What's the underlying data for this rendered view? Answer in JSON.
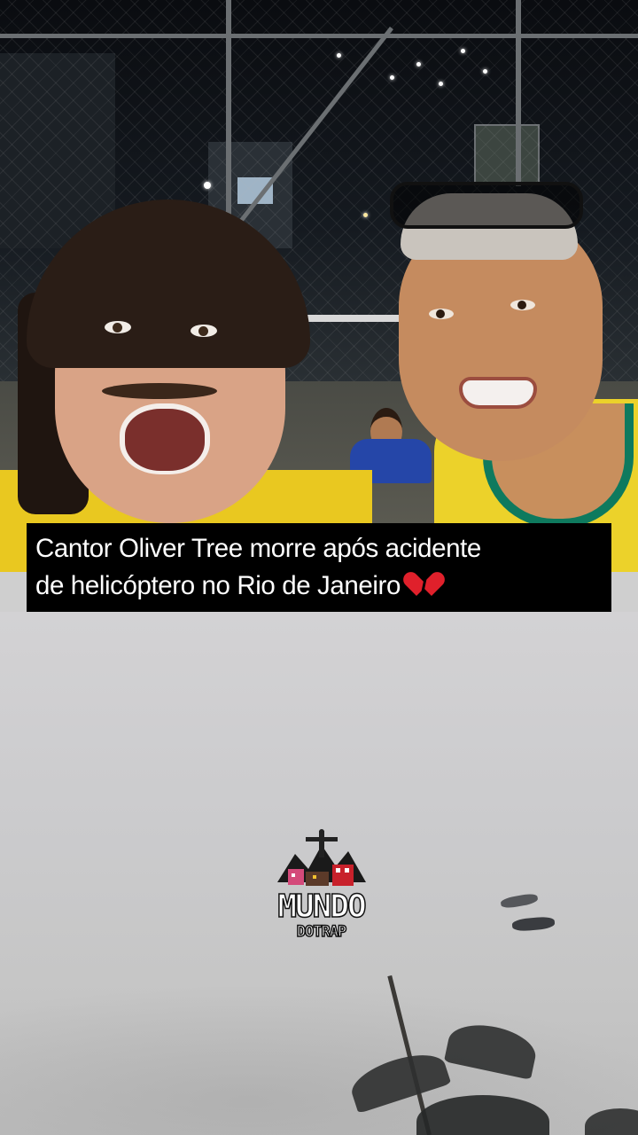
{
  "caption": {
    "line1": "Cantor Oliver Tree morre após acidente",
    "line2": "de helicóptero no Rio de Janeiro",
    "emoji": "broken-heart-icon"
  },
  "logo": {
    "line1": "MUNDO",
    "line2": "DOTRAP"
  },
  "colors": {
    "caption_bg": "#000000",
    "caption_text": "#ffffff",
    "heart": "#e0202b",
    "jersey_yellow": "#e9c820",
    "jersey_green": "#0e7a5e"
  }
}
